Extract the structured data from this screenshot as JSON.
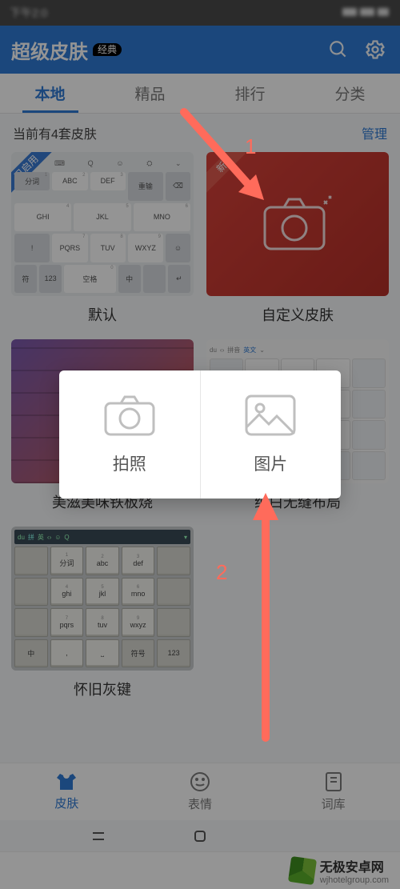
{
  "statusbar": {
    "time": "下午2:0"
  },
  "header": {
    "title": "超级皮肤",
    "badge": "经典"
  },
  "tabs": {
    "items": [
      "本地",
      "精品",
      "排行",
      "分类"
    ],
    "active_index": 0
  },
  "inforow": {
    "count_text": "当前有4套皮肤",
    "manage": "管理"
  },
  "cards": [
    {
      "label": "默认",
      "ribbon": "已启用"
    },
    {
      "label": "自定义皮肤",
      "ribbon": "新"
    },
    {
      "label": "美滋美味铁板烧"
    },
    {
      "label": "纯白无缝布局"
    },
    {
      "label": "怀旧灰键"
    }
  ],
  "keys_default": {
    "row1": [
      "分词",
      "ABC",
      "DEF",
      "重输"
    ],
    "row1_sup": [
      "1",
      "2",
      "3",
      ""
    ],
    "row2": [
      "GHI",
      "JKL",
      "MNO"
    ],
    "row2_sup": [
      "4",
      "5",
      "6"
    ],
    "row3": [
      "PQRS",
      "TUV",
      "WXYZ"
    ],
    "row3_sup": [
      "7",
      "8",
      "9"
    ],
    "row4": [
      "符",
      "123",
      "空格",
      "中"
    ],
    "row4_sup": [
      "",
      "",
      "0",
      ""
    ]
  },
  "keys_retro": {
    "r1": [
      "分词",
      "abc",
      "def"
    ],
    "r2": [
      "ghi",
      "jkl",
      "mno"
    ],
    "r3": [
      "pqrs",
      "tuv",
      "wxyz"
    ],
    "r4": [
      "中",
      "",
      "符号",
      "123"
    ],
    "top_items": [
      "拼",
      "英"
    ]
  },
  "keys_white": {
    "top_items": [
      "拼音",
      "英文"
    ]
  },
  "modal": {
    "photo": "拍照",
    "image": "图片"
  },
  "tabbar": {
    "items": [
      "皮肤",
      "表情",
      "词库"
    ],
    "active_index": 0
  },
  "annotations": {
    "a1": "1",
    "a2": "2"
  },
  "footer": {
    "brand": "无极安卓网",
    "url": "wjhotelgroup.com"
  }
}
